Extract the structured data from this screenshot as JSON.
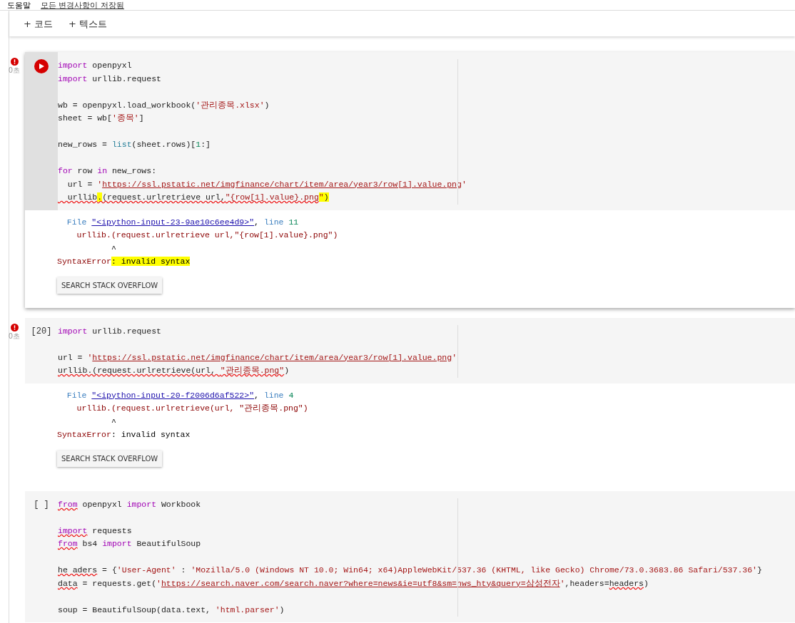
{
  "header": {
    "menu": "도움말",
    "save_status": "모든 변경사항이 저장됨"
  },
  "toolbar": [
    {
      "icon": "+",
      "label": "코드"
    },
    {
      "icon": "+",
      "label": "텍스트"
    }
  ],
  "cells": [
    {
      "focused": true,
      "error": true,
      "time": "0초",
      "gutter": {
        "kind": "run-button"
      },
      "lines": [
        {
          "tokens": [
            {
              "kind": "kw",
              "text": "import"
            },
            {
              "kind": "plain",
              "text": " openpyxl"
            }
          ]
        },
        {
          "tokens": [
            {
              "kind": "kw",
              "text": "import"
            },
            {
              "kind": "plain",
              "text": " urllib.request"
            }
          ]
        },
        {
          "gap_before": true,
          "tokens": [
            {
              "kind": "plain",
              "text": "wb = openpyxl.load_workbook("
            },
            {
              "kind": "str",
              "text": "'관리종목.xlsx'"
            },
            {
              "kind": "plain",
              "text": ")"
            }
          ]
        },
        {
          "tokens": [
            {
              "kind": "plain",
              "text": "sheet = wb["
            },
            {
              "kind": "str",
              "text": "'종목'"
            },
            {
              "kind": "plain",
              "text": "]"
            }
          ]
        },
        {
          "gap_before": true,
          "tokens": [
            {
              "kind": "plain",
              "text": "new_rows = "
            },
            {
              "kind": "builtin",
              "text": "list"
            },
            {
              "kind": "plain",
              "text": "(sheet.rows)["
            },
            {
              "kind": "num",
              "text": "1"
            },
            {
              "kind": "plain",
              "text": ":]"
            }
          ]
        },
        {
          "gap_before": true,
          "tokens": [
            {
              "kind": "kw",
              "text": "for"
            },
            {
              "kind": "plain",
              "text": " row "
            },
            {
              "kind": "kw",
              "text": "in"
            },
            {
              "kind": "plain",
              "text": " new_rows:"
            }
          ]
        },
        {
          "tokens": [
            {
              "kind": "plain",
              "text": "  url = "
            },
            {
              "kind": "str",
              "text": "'"
            },
            {
              "kind": "url",
              "text": "https://ssl.pstatic.net/imgfinance/chart/item/area/year3/row[1].value.png"
            },
            {
              "kind": "str",
              "text": "'"
            }
          ]
        },
        {
          "tokens": [
            {
              "kind": "plain",
              "text": "  urllib",
              "squiggle": true
            },
            {
              "kind": "plain",
              "text": ".",
              "squiggle": true,
              "highlight": true
            },
            {
              "kind": "plain",
              "text": "(request.urlretrieve url,",
              "squiggle": true
            },
            {
              "kind": "str",
              "text": "\"{row[1].value}.png",
              "squiggle": true
            },
            {
              "kind": "str",
              "text": "\"",
              "highlight": true
            },
            {
              "kind": "plain",
              "text": ")",
              "highlight": true
            }
          ]
        }
      ],
      "output": {
        "file_label": "File ",
        "file_link": "\"<ipython-input-23-9ae10c6ee4d9>\"",
        "separator": ", ",
        "line_label": "line ",
        "line_number": "11",
        "code": "    urllib.(request.urlretrieve url,\"{row[1].value}.png\")",
        "caret": "           ^",
        "error_name": "SyntaxError",
        "error_message": ": invalid syntax",
        "highlight": true,
        "button": "SEARCH STACK OVERFLOW"
      }
    },
    {
      "focused": false,
      "error": true,
      "time": "0초",
      "gutter": {
        "kind": "prompt",
        "text": "[20]"
      },
      "lines": [
        {
          "tokens": [
            {
              "kind": "kw",
              "text": "import"
            },
            {
              "kind": "plain",
              "text": " urllib.request"
            }
          ]
        },
        {
          "gap_before": true,
          "tokens": [
            {
              "kind": "plain",
              "text": "url = "
            },
            {
              "kind": "str",
              "text": "'"
            },
            {
              "kind": "url",
              "text": "https://ssl.pstatic.net/imgfinance/chart/item/area/year3/row[1].value.png"
            },
            {
              "kind": "str",
              "text": "'"
            }
          ]
        },
        {
          "tokens": [
            {
              "kind": "plain",
              "text": "urllib.(request.urlretrieve(url, ",
              "squiggle": true
            },
            {
              "kind": "str",
              "text": "\"관리종목.png\"",
              "squiggle": true
            },
            {
              "kind": "plain",
              "text": ")"
            }
          ]
        }
      ],
      "output": {
        "file_label": "File ",
        "file_link": "\"<ipython-input-20-f2006d6af522>\"",
        "separator": ", ",
        "line_label": "line ",
        "line_number": "4",
        "code": "    urllib.(request.urlretrieve(url, \"관리종목.png\")",
        "caret": "           ^",
        "error_name": "SyntaxError",
        "error_message": ": invalid syntax",
        "highlight": false,
        "button": "SEARCH STACK OVERFLOW"
      }
    },
    {
      "focused": false,
      "error": false,
      "gutter": {
        "kind": "prompt",
        "text": "[ ]"
      },
      "lines": [
        {
          "tokens": [
            {
              "kind": "kw",
              "text": "from",
              "squiggle": true
            },
            {
              "kind": "plain",
              "text": " openpyxl "
            },
            {
              "kind": "kw",
              "text": "import"
            },
            {
              "kind": "plain",
              "text": " Workbook"
            }
          ]
        },
        {
          "gap_before": true,
          "tokens": [
            {
              "kind": "kw",
              "text": "import",
              "squiggle": true
            },
            {
              "kind": "plain",
              "text": " requests"
            }
          ]
        },
        {
          "tokens": [
            {
              "kind": "kw",
              "text": "from",
              "squiggle": true
            },
            {
              "kind": "plain",
              "text": " bs4 "
            },
            {
              "kind": "kw",
              "text": "import"
            },
            {
              "kind": "plain",
              "text": " BeautifulSoup"
            }
          ]
        },
        {
          "gap_before": true,
          "tokens": [
            {
              "kind": "plain",
              "text": "he aders",
              "squiggle": true
            },
            {
              "kind": "plain",
              "text": " = {"
            },
            {
              "kind": "str",
              "text": "'User-Agent'"
            },
            {
              "kind": "plain",
              "text": " : "
            },
            {
              "kind": "str",
              "text": "'Mozilla/5.0 (Windows NT 10.0; Win64; x64)AppleWebKit/537.36 (KHTML, like Gecko) Chrome/73.0.3683.86 Safari/537.36'"
            },
            {
              "kind": "plain",
              "text": "}"
            }
          ]
        },
        {
          "tokens": [
            {
              "kind": "plain",
              "text": "data",
              "squiggle": true
            },
            {
              "kind": "plain",
              "text": " = requests.get("
            },
            {
              "kind": "str",
              "text": "'"
            },
            {
              "kind": "url",
              "text": "https://search.naver.com/search.naver?where=news&ie=utf8&sm=nws_hty&query=삼성전자"
            },
            {
              "kind": "str",
              "text": "'"
            },
            {
              "kind": "plain",
              "text": ",headers="
            },
            {
              "kind": "plain",
              "text": "headers",
              "squiggle": true
            },
            {
              "kind": "plain",
              "text": ")"
            }
          ]
        },
        {
          "gap_before": true,
          "tokens": [
            {
              "kind": "plain",
              "text": "soup = BeautifulSoup(data.text, "
            },
            {
              "kind": "str",
              "text": "'html.parser'"
            },
            {
              "kind": "plain",
              "text": ")"
            }
          ]
        }
      ]
    }
  ]
}
